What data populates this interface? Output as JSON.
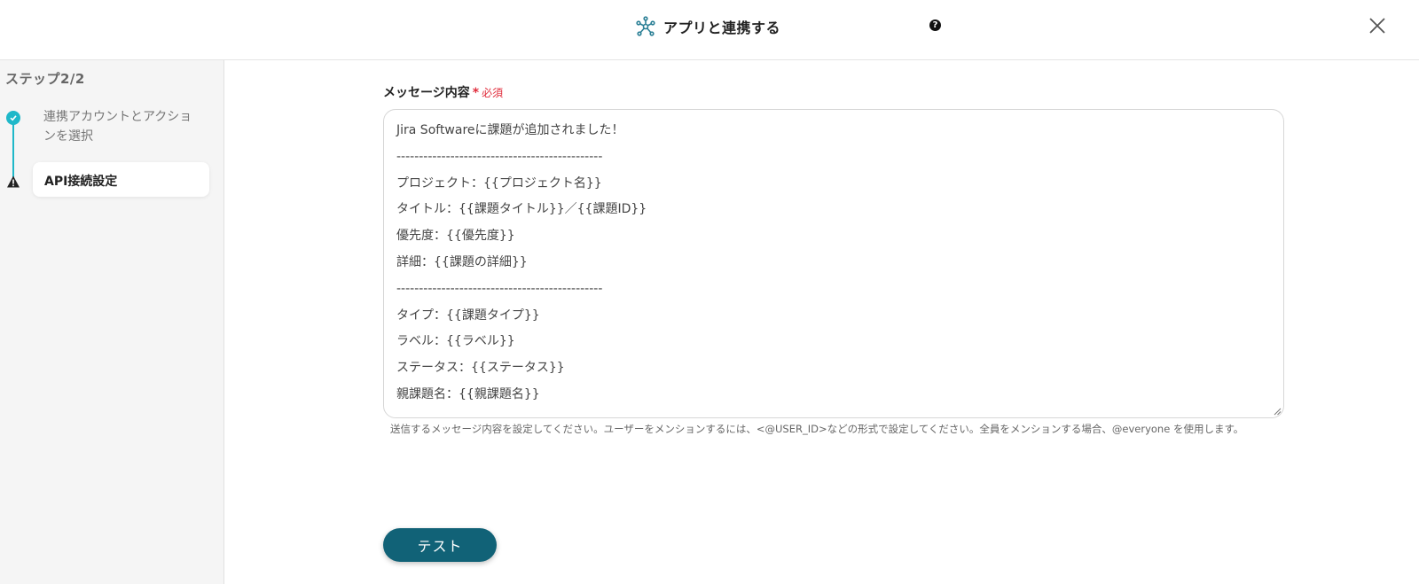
{
  "header": {
    "title": "アプリと連携する",
    "help_icon": "?",
    "close_icon": "close-icon",
    "accent_color": "#1fb8c9"
  },
  "sidebar": {
    "step_heading": "ステップ2/2",
    "steps": [
      {
        "label": "連携アカウントとアクションを選択",
        "status": "completed"
      },
      {
        "label": "API接続設定",
        "status": "warning",
        "active": true
      }
    ]
  },
  "form": {
    "field_label": "メッセージ内容",
    "required_star": "*",
    "required_text": "必須",
    "message_lines": [
      "Jira Softwareに課題が追加されました！",
      "----------------------------------------------",
      "プロジェクト：{{プロジェクト名}}",
      "タイトル：{{課題タイトル}}／{{課題ID}}",
      "優先度：{{優先度}}",
      "詳細：{{課題の詳細}}",
      "----------------------------------------------",
      "タイプ：{{課題タイプ}}",
      "ラベル：{{ラベル}}",
      "ステータス：{{ステータス}}",
      "親課題名：{{親課題名}}"
    ],
    "hint": "送信するメッセージ内容を設定してください。ユーザーをメンションするには、<@USER_ID>などの形式で設定してください。全員をメンションする場合、@everyone を使用します。",
    "test_button": "テスト",
    "button_color": "#116277",
    "required_color": "#e02d3c"
  }
}
